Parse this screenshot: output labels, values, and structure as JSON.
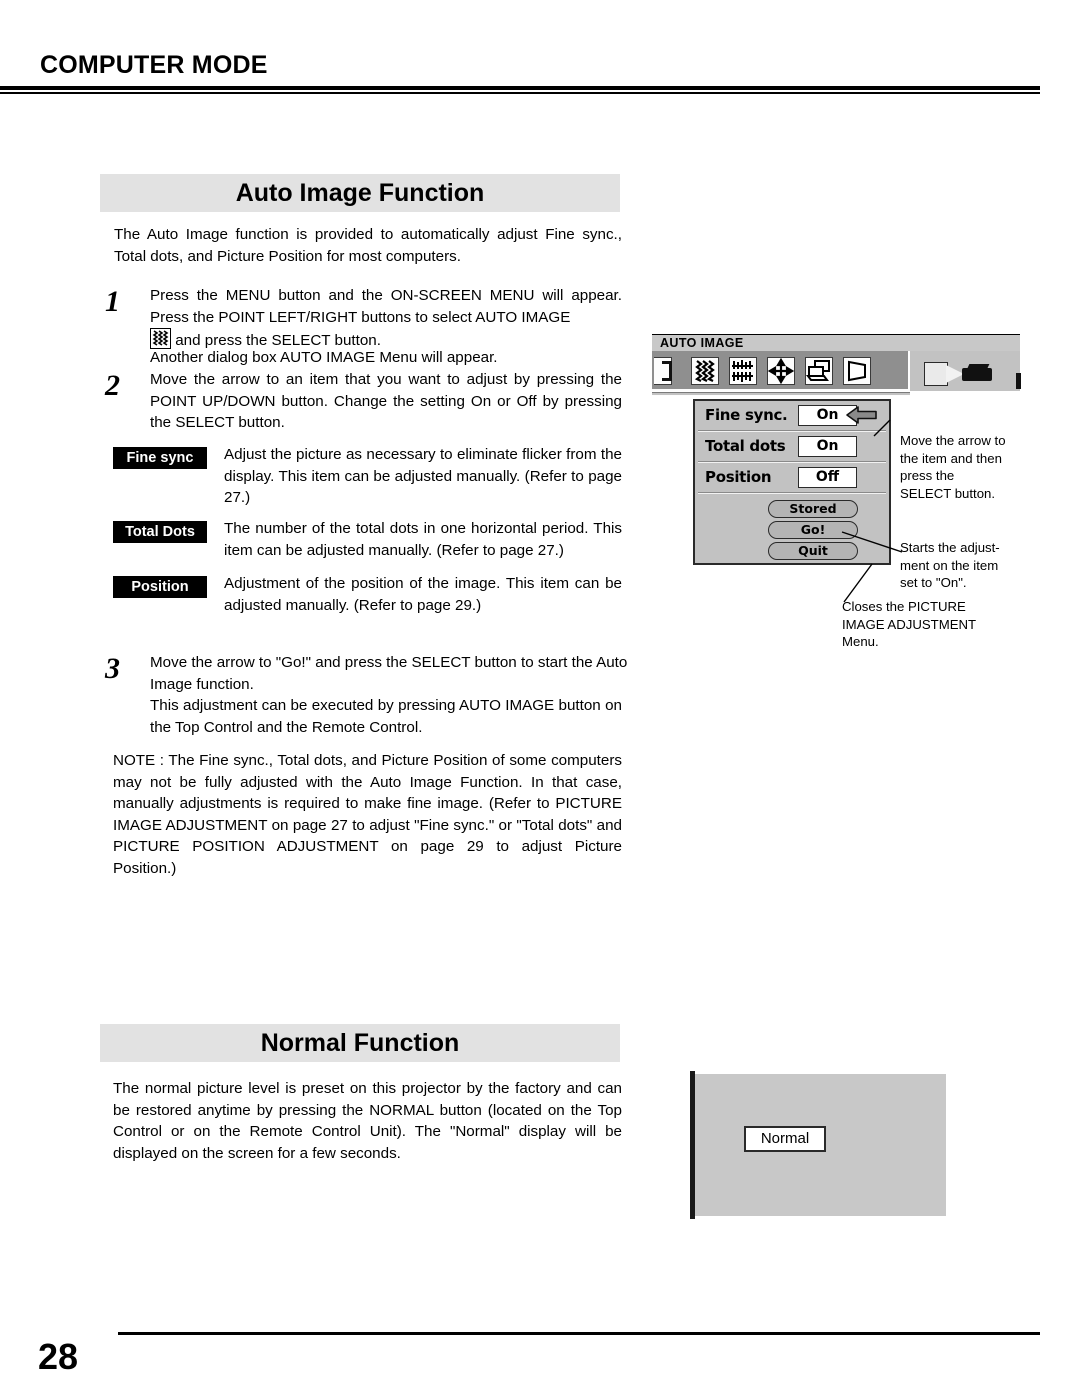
{
  "header": {
    "title": "COMPUTER MODE"
  },
  "sections": {
    "auto_image": {
      "banner": "Auto Image Function",
      "intro": "The Auto Image function is provided to automatically adjust Fine sync., Total dots, and Picture Position for most computers.",
      "steps": [
        {
          "number": "1",
          "line1": "Press the MENU button and the ON-SCREEN MENU will appear. Press the POINT LEFT/RIGHT buttons to select AUTO IMAGE",
          "icon": "auto-image-zigzag-icon",
          "line2": "and press the SELECT button.",
          "line3": "Another dialog box AUTO IMAGE Menu will appear."
        },
        {
          "number": "2",
          "text": "Move the arrow to an item that you want to adjust by pressing the POINT UP/DOWN button.  Change the setting On or Off by pressing the SELECT button."
        },
        {
          "number": "3",
          "text": "Move the arrow to \"Go!\" and press the SELECT button to start the Auto Image function.",
          "text2": "This adjustment can be executed by pressing AUTO IMAGE button on the Top Control and the Remote Control."
        }
      ],
      "items": [
        {
          "tag": "Fine sync",
          "desc": "Adjust the picture as necessary to eliminate flicker from the display.  This item can be adjusted manually.  (Refer to page 27.)"
        },
        {
          "tag": "Total Dots",
          "desc": "The number of the total dots in one horizontal period.  This item can be adjusted manually.  (Refer to page 27.)"
        },
        {
          "tag": "Position",
          "desc": "Adjustment of the position of the image.  This item can be adjusted manually.  (Refer to page 29.)"
        }
      ],
      "note": "NOTE : The Fine sync., Total dots, and Picture Position of some computers may not be fully adjusted with the Auto Image Function.  In that case, manually adjustments is required to make fine image.  (Refer to PICTURE IMAGE ADJUSTMENT on page 27 to adjust \"Fine sync.\" or \"Total dots\" and PICTURE POSITION ADJUSTMENT on page 29 to adjust Picture Position.)"
    },
    "normal": {
      "banner": "Normal Function",
      "body": "The normal picture level is preset on this projector by the factory and can be restored anytime by pressing the NORMAL button (located on the Top Control or on the Remote Control Unit).  The \"Normal\" display will be displayed on the screen for a few seconds.",
      "display_label": "Normal"
    }
  },
  "osd": {
    "menu_title": "AUTO IMAGE",
    "icons": [
      "partial-bracket-icon",
      "fine-sync-zigzag-icon",
      "total-dots-bars-icon",
      "position-arrows-icon",
      "computer-screen-icon",
      "keystone-icon"
    ],
    "projector_icon": "projector-icon",
    "dialog": {
      "rows": [
        {
          "label": "Fine sync.",
          "value": "On"
        },
        {
          "label": "Total dots",
          "value": "On"
        },
        {
          "label": "Position",
          "value": "Off"
        }
      ],
      "buttons": [
        "Stored",
        "Go!",
        "Quit"
      ],
      "pointer": "left-arrow-pointer-icon"
    },
    "callouts": [
      "Move the arrow to the item and then press the SELECT button.",
      "Starts the adjust-ment on the item set to \"On\".",
      "Closes the PICTURE IMAGE ADJUSTMENT Menu."
    ],
    "callout_lines": {
      "c1": [
        "Move the arrow to",
        "the item and then",
        "press the",
        "SELECT button."
      ],
      "c2": [
        "Starts the adjust-",
        "ment on the item",
        "set to \"On\"."
      ],
      "c3": [
        "Closes the PICTURE",
        "IMAGE ADJUSTMENT",
        "Menu."
      ]
    }
  },
  "footer": {
    "page_number": "28"
  },
  "colors": {
    "banner_bg": "#e2e2e2",
    "tag_bg": "#000000",
    "osd_bg": "#c2c2c2",
    "osd_well": "#8f8f8f"
  }
}
